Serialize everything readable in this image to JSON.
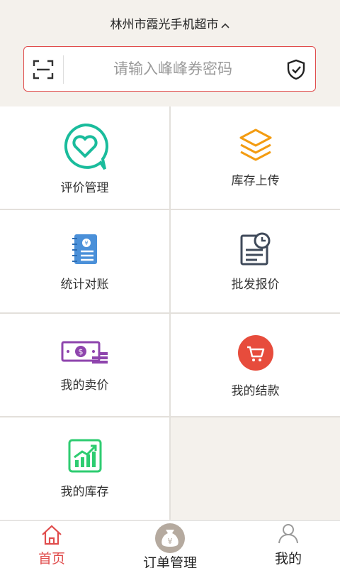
{
  "header": {
    "store_name": "林州市霞光手机超市",
    "search_placeholder": "请输入峰峰券密码"
  },
  "menu": [
    {
      "label": "评价管理",
      "icon": "heart-chat-icon"
    },
    {
      "label": "库存上传",
      "icon": "layers-icon"
    },
    {
      "label": "统计对账",
      "icon": "ledger-book-icon"
    },
    {
      "label": "批发报价",
      "icon": "document-clock-icon"
    },
    {
      "label": "我的卖价",
      "icon": "cash-icon"
    },
    {
      "label": "我的结款",
      "icon": "cart-icon"
    },
    {
      "label": "我的库存",
      "icon": "chart-up-icon"
    }
  ],
  "tabs": [
    {
      "label": "首页",
      "icon": "home-icon",
      "active": true
    },
    {
      "label": "订单管理",
      "icon": "money-bag-icon",
      "active": false
    },
    {
      "label": "我的",
      "icon": "user-icon",
      "active": false
    }
  ],
  "colors": {
    "accent_red": "#e04c4c",
    "teal": "#1abc9c",
    "orange": "#f39c12",
    "blue": "#4a90d9",
    "slate": "#3f4a5a",
    "purple": "#8e44ad",
    "green": "#2ecc71",
    "tab_active": "#e04c4c"
  }
}
